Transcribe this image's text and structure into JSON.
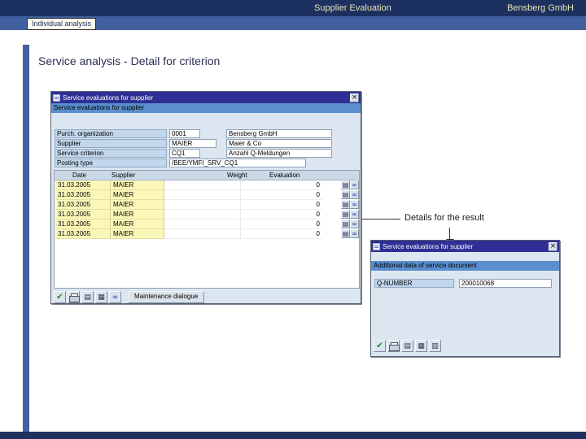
{
  "header": {
    "title": "Supplier Evaluation",
    "company": "Bensberg GmbH"
  },
  "nav": {
    "tab": "Individual analysis"
  },
  "page": {
    "title": "Service analysis - Detail for criterion",
    "annotation": "Details for the result"
  },
  "main_dialog": {
    "title": "Service evaluations for supplier",
    "section_header": "Service evaluations for supplier",
    "fields": [
      {
        "label": "Purch. organization",
        "value": "0001",
        "text": "Bensberg GmbH"
      },
      {
        "label": "Supplier",
        "value": "MAIER",
        "text": "Maier & Co"
      },
      {
        "label": "Service criterion",
        "value": "CQ1",
        "text": "Anzahl Q-Meldungen"
      },
      {
        "label": "Posting type",
        "value": "/BEE/YMFI_SRV_CQ1",
        "text": ""
      }
    ],
    "table": {
      "columns": [
        "Date",
        "Supplier",
        "Weight",
        "Evaluation"
      ],
      "rows": [
        {
          "date": "31.03.2005",
          "supplier": "MAIER",
          "weight": "",
          "evaluation": "0"
        },
        {
          "date": "31.03.2005",
          "supplier": "MAIER",
          "weight": "",
          "evaluation": "0"
        },
        {
          "date": "31.03.2005",
          "supplier": "MAIER",
          "weight": "",
          "evaluation": "0"
        },
        {
          "date": "31.03.2005",
          "supplier": "MAIER",
          "weight": "",
          "evaluation": "0"
        },
        {
          "date": "31.03.2005",
          "supplier": "MAIER",
          "weight": "",
          "evaluation": "0"
        },
        {
          "date": "31.03.2005",
          "supplier": "MAIER",
          "weight": "",
          "evaluation": "0"
        }
      ]
    },
    "toolbar": {
      "icons": [
        "confirm-icon",
        "print-icon",
        "print-preview-icon",
        "grid-icon",
        "find-icon"
      ],
      "maintenance_label": "Maintenance dialogue"
    },
    "row_icons": [
      "display-document-icon",
      "display-details-icon"
    ]
  },
  "detail_dialog": {
    "title": "Service evaluations for supplier",
    "section_header": "Additional data of service document",
    "field": {
      "label": "Q-NUMBER",
      "value": "200010068"
    },
    "toolbar": {
      "icons": [
        "confirm-icon",
        "print-icon",
        "page-icon",
        "grid-icon",
        "grid2-icon"
      ]
    }
  },
  "colors": {
    "header_bar": "#1d3161",
    "accent_bar": "#40609f",
    "sap_titlebar": "#2f2f95",
    "section_band": "#5a8ecd",
    "yellow_cell": "#fbf7b8",
    "dialog_background": "#dce6f1"
  }
}
